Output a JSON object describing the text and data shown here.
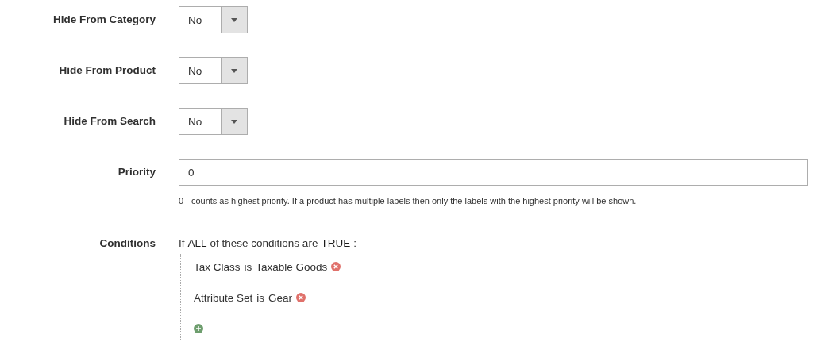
{
  "fields": [
    {
      "kind": "select",
      "label": "Hide From Category",
      "value": "No"
    },
    {
      "kind": "select",
      "label": "Hide From Product",
      "value": "No"
    },
    {
      "kind": "select",
      "label": "Hide From Search",
      "value": "No"
    },
    {
      "kind": "input",
      "label": "Priority",
      "value": "0",
      "note": "0 - counts as highest priority. If a product has multiple labels then only the labels with the highest priority will be shown."
    }
  ],
  "conditions": {
    "label": "Conditions",
    "intro": [
      "If",
      "ALL",
      "of these conditions are",
      "TRUE",
      ":"
    ],
    "items": [
      {
        "attribute": "Tax Class",
        "operator": "is",
        "value": "Taxable Goods"
      },
      {
        "attribute": "Attribute Set",
        "operator": "is",
        "value": "Gear"
      }
    ]
  }
}
